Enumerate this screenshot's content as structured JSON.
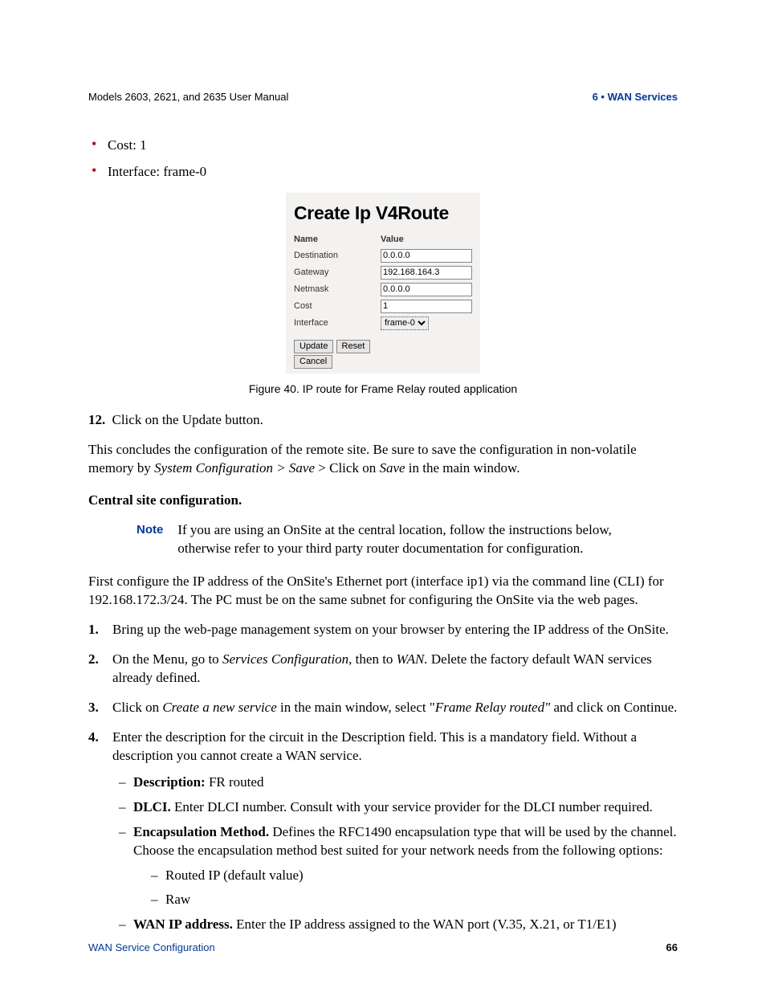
{
  "header": {
    "left": "Models 2603, 2621, and 2635 User Manual",
    "right": "6 • WAN Services"
  },
  "bullets": {
    "cost": "Cost: 1",
    "interface": "Interface: frame-0"
  },
  "figure": {
    "title": "Create Ip V4Route",
    "head_name": "Name",
    "head_value": "Value",
    "rows": {
      "destination_label": "Destination",
      "destination_value": "0.0.0.0",
      "gateway_label": "Gateway",
      "gateway_value": "192.168.164.3",
      "netmask_label": "Netmask",
      "netmask_value": "0.0.0.0",
      "cost_label": "Cost",
      "cost_value": "1",
      "interface_label": "Interface",
      "interface_option": "frame-0"
    },
    "buttons": {
      "update": "Update",
      "reset": "Reset",
      "cancel": "Cancel"
    },
    "caption": "Figure 40. IP route for Frame Relay routed application"
  },
  "step12": {
    "num": "12.",
    "text": "Click on the Update button."
  },
  "conclude_a": "This concludes the configuration of the remote site. Be sure to save the configuration in non-volatile memory by ",
  "conclude_b_i": "System Configuration > Save",
  "conclude_c": " > Click on ",
  "conclude_d_i": "Save",
  "conclude_e": " in the main window.",
  "central_head": "Central site configuration.",
  "note_label": "Note",
  "note_body": "If you are using an OnSite at the central location, follow the instructions below, otherwise refer to your third party router documentation for configuration.",
  "first_para": "First configure the IP address of the OnSite's Ethernet port (interface ip1) via the command line (CLI) for 192.168.172.3/24. The PC must be on the same subnet for configuring the OnSite via the web pages.",
  "steps": {
    "s1": "Bring up the web-page management system on your browser by entering the IP address of the OnSite.",
    "s2_a": "On the Menu, go to ",
    "s2_b_i": "Services Configuration",
    "s2_c": ", then to ",
    "s2_d_i": "WAN.",
    "s2_e": " Delete the factory default WAN services already defined.",
    "s3_a": "Click on ",
    "s3_b_i": "Create a new service",
    "s3_c": " in the main window, select \"",
    "s3_d_i": "Frame Relay routed\"",
    "s3_e": " and click on Continue.",
    "s4": "Enter the description for the circuit in the Description field. This is a mandatory field. Without a description you cannot create a WAN service.",
    "s4_desc_b": "Description:",
    "s4_desc_t": " FR routed",
    "s4_dlci_b": "DLCI.",
    "s4_dlci_t": " Enter DLCI number. Consult with your service provider for the DLCI number required.",
    "s4_enc_b": "Encapsulation Method.",
    "s4_enc_t": " Defines the RFC1490 encapsulation type that will be used by the channel. Choose the encapsulation method best suited for your network needs from the following options:",
    "s4_enc_opt1": "Routed IP (default value)",
    "s4_enc_opt2": "Raw",
    "s4_wan_b": "WAN IP address.",
    "s4_wan_t": " Enter the IP address assigned to the WAN port (V.35, X.21, or T1/E1)"
  },
  "footer": {
    "left": "WAN Service Configuration",
    "right": "66"
  }
}
